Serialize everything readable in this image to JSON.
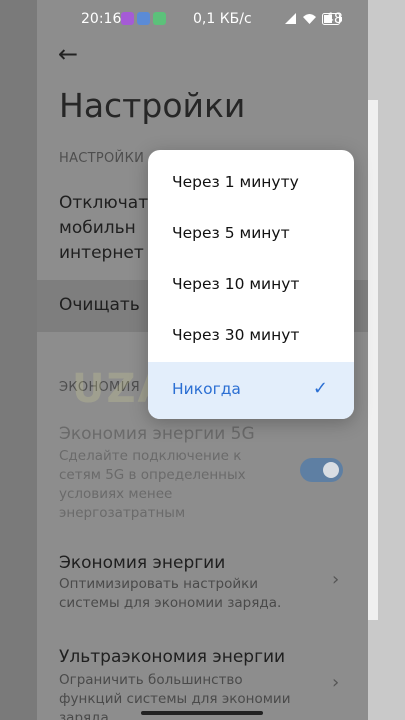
{
  "status_bar": {
    "time": "20:16",
    "net_speed": "0,1 КБ/с",
    "battery": "48",
    "app_icon_colors": [
      "#a55bd6",
      "#5b8bd6",
      "#5cc17a"
    ]
  },
  "header": {
    "back_icon": "arrow-left-icon",
    "title": "Настройки"
  },
  "settings": {
    "section1_label": "НАСТРОЙКИ",
    "row1_line1": "Отключат",
    "row1_line2": "мобильн",
    "row1_line3": "интернет",
    "row2_label": "Очищать",
    "section2_label": "ЭКОНОМИЯ",
    "row3_title": "Экономия энергии 5G",
    "row3_sub": "Сделайте подключение к сетям 5G в определенных условиях менее энергозатратным",
    "row3_toggle_on": true,
    "row4_title": "Экономия энергии",
    "row4_sub": "Оптимизировать настройки системы для экономии заряда.",
    "row5_title": "Ультраэкономия энергии",
    "row5_sub": "Ограничить большинство функций системы для экономии заряда."
  },
  "watermark": "UZANDRO",
  "popup": {
    "options": [
      {
        "label": "Через 1 минуту",
        "selected": false
      },
      {
        "label": "Через 5 минут",
        "selected": false
      },
      {
        "label": "Через 10 минут",
        "selected": false
      },
      {
        "label": "Через 30 минут",
        "selected": false
      },
      {
        "label": "Никогда",
        "selected": true
      }
    ],
    "check_icon": "checkmark-icon"
  },
  "colors": {
    "accent": "#2b6fd3",
    "selected_bg": "#e3eefb",
    "toggle": "#5e7fa3"
  }
}
